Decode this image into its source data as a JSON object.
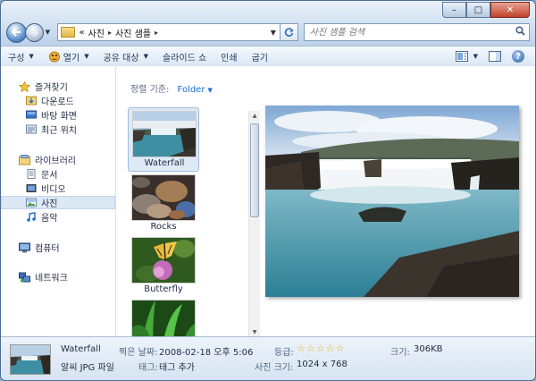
{
  "window": {
    "caption_buttons": {
      "minimize": "–",
      "maximize": "□",
      "close": "✕"
    }
  },
  "address_bar": {
    "overflow": "«",
    "crumbs": [
      "사진",
      "사진 샘플"
    ],
    "separator": "▸"
  },
  "search": {
    "placeholder": "사진 샘플 검색"
  },
  "toolbar": {
    "items": [
      {
        "label": "구성",
        "dropdown": true
      },
      {
        "label": "열기",
        "dropdown": true
      },
      {
        "label": "공유 대상",
        "dropdown": true
      },
      {
        "label": "슬라이드 쇼",
        "dropdown": false
      },
      {
        "label": "인쇄",
        "dropdown": false
      },
      {
        "label": "굽기",
        "dropdown": false
      }
    ],
    "help": "?"
  },
  "nav_pane": {
    "favorites": {
      "label": "즐겨찾기",
      "items": [
        "다운로드",
        "바탕 화면",
        "최근 위치"
      ]
    },
    "libraries": {
      "label": "라이브러리",
      "items": [
        "문서",
        "비디오",
        "사진",
        "음악"
      ],
      "selected": "사진"
    },
    "computer": "컴퓨터",
    "network": "네트워크"
  },
  "file_list": {
    "arrange_label": "정렬 기준:",
    "arrange_value": "Folder",
    "items": [
      {
        "name": "Waterfall",
        "selected": true
      },
      {
        "name": "Rocks",
        "selected": false
      },
      {
        "name": "Butterfly",
        "selected": false
      }
    ]
  },
  "details": {
    "name": "Waterfall",
    "type": "알씨 JPG 파일",
    "date_label": "찍은 날짜:",
    "date_value": "2008-02-18 오후 5:06",
    "tags_label": "태그:",
    "tags_value": "태그 추가",
    "rating_label": "등급:",
    "rating_value": 0,
    "rating_max": 5,
    "dimensions_label": "사진 크기:",
    "dimensions_value": "1024 x 768",
    "size_label": "크기:",
    "size_value": "306KB"
  },
  "colors": {
    "accent": "#1a6ad6",
    "selection": "#dde8f5",
    "chrome": "#b7cde6"
  }
}
